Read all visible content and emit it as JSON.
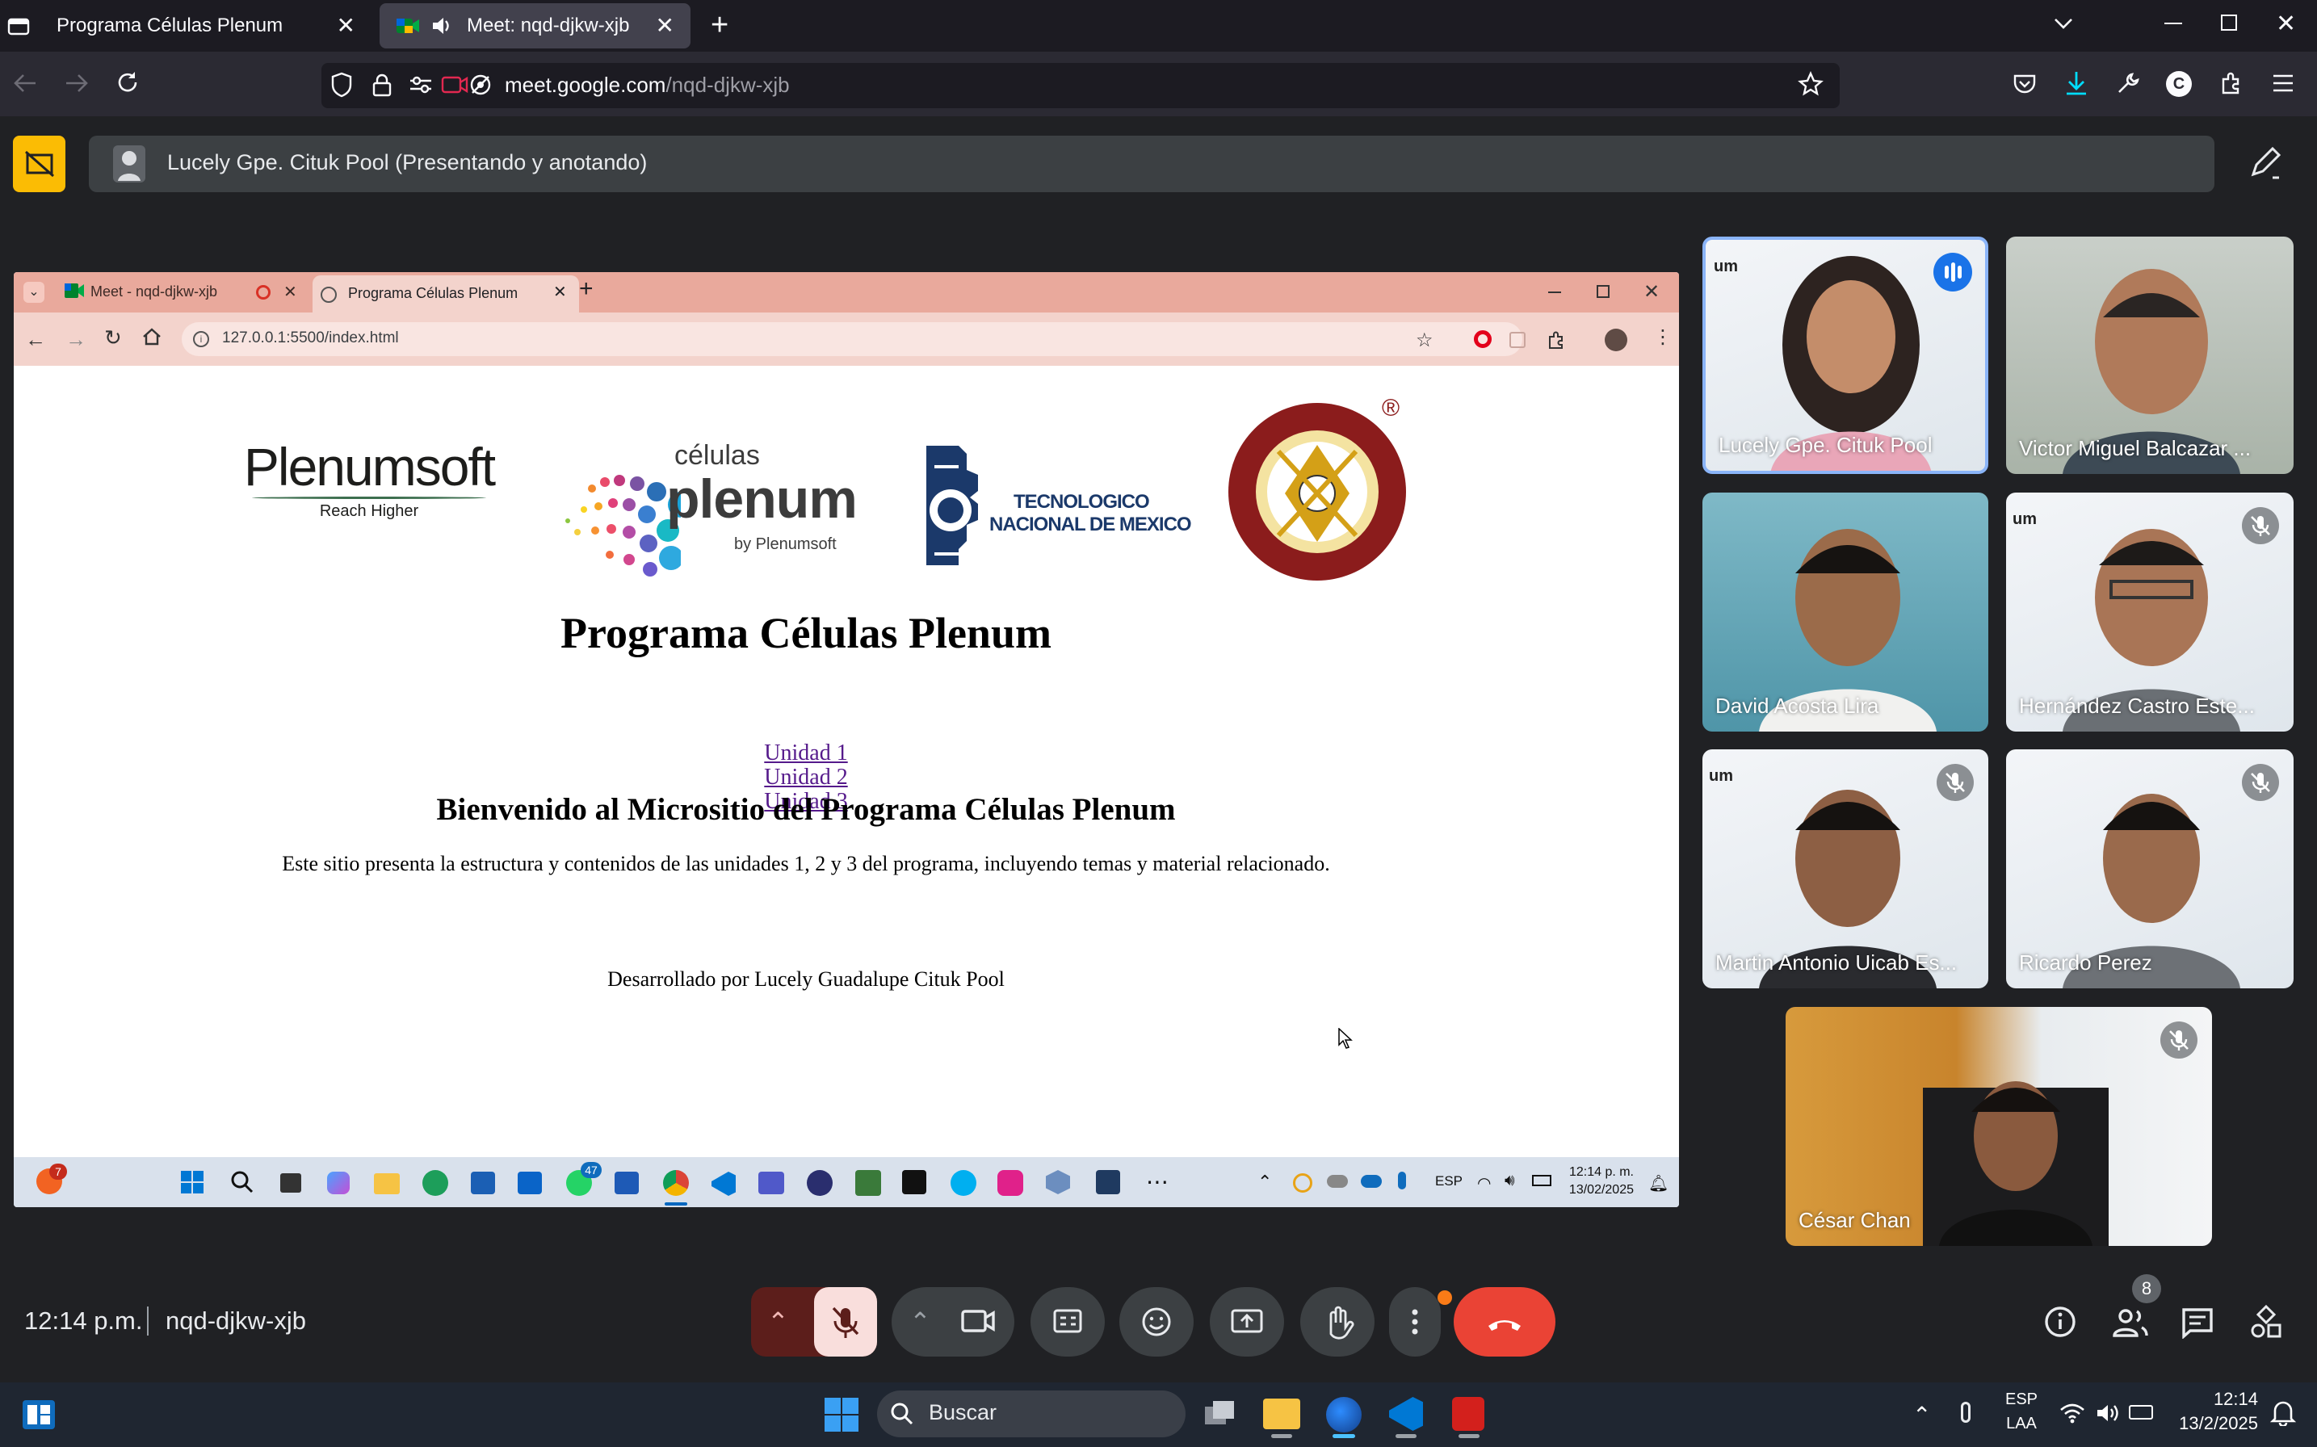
{
  "browser": {
    "tabs": [
      {
        "title": "Programa Células Plenum",
        "active": false
      },
      {
        "title": "Meet: nqd-djkw-xjb",
        "active": true
      }
    ],
    "url_domain": "meet.google.com",
    "url_path": "/nqd-djkw-xjb",
    "icons": [
      "all-tabs-icon",
      "audio-playing-icon",
      "new-tab-icon",
      "tab-list-chevron-icon",
      "minimize-icon",
      "restore-icon",
      "close-icon",
      "back-icon",
      "forward-icon",
      "reload-icon",
      "shield-icon",
      "lock-icon",
      "permissions-icon",
      "camera-blocked-icon",
      "tracking-icon",
      "bookmark-star-icon",
      "pocket-icon",
      "download-icon",
      "wrench-icon",
      "account-icon",
      "extensions-icon",
      "menu-icon"
    ]
  },
  "meet": {
    "presenter_label": "Lucely Gpe. Cituk Pool (Presentando y anotando)",
    "time": "12:14 p.m.",
    "meeting_code": "nqd-djkw-xjb",
    "people_count": "8",
    "accent": "#8ab4f8",
    "end_call_color": "#ea4335"
  },
  "shared_screen": {
    "tabs": [
      {
        "title": "Meet - nqd-djkw-xjb"
      },
      {
        "title": "Programa Células Plenum"
      }
    ],
    "url": "127.0.0.1:5500/index.html",
    "page": {
      "logos": {
        "plenumsoft": "Plenumsoft",
        "plenumsoft_tagline": "Reach Higher",
        "celulas_top": "células",
        "celulas_main": "plenum",
        "celulas_by": "by Plenumsoft",
        "tecnm_line1": "TECNOLOGICO",
        "tecnm_line2": "NACIONAL DE MEXICO",
        "itm_seal": "INSTITUTO TECNOLOGICO · MERIDA YUCATAN",
        "itm_mark": "®"
      },
      "title": "Programa Células Plenum",
      "links": [
        "Unidad 1",
        "Unidad 2",
        "Unidad 3"
      ],
      "welcome": "Bienvenido al Micrositio del Programa Células Plenum",
      "description": "Este sitio presenta la estructura y contenidos de las unidades 1, 2 y 3 del programa, incluyendo temas y material relacionado.",
      "developer": "Desarrollado por Lucely Guadalupe Cituk Pool"
    },
    "taskbar": {
      "notification_badge": "7",
      "whatsapp_badge": "47",
      "lang": "ESP",
      "time": "12:14 p. m.",
      "date": "13/02/2025"
    }
  },
  "participants": [
    {
      "name": "Lucely Gpe. Cituk Pool",
      "speaking": true,
      "muted": false
    },
    {
      "name": "Victor Miguel Balcazar ...",
      "speaking": false,
      "muted": false
    },
    {
      "name": "David Acosta Lira",
      "speaking": false,
      "muted": false
    },
    {
      "name": "Hernández Castro Este...",
      "speaking": false,
      "muted": true
    },
    {
      "name": "Martin Antonio Uicab Es...",
      "speaking": false,
      "muted": true
    },
    {
      "name": "Ricardo Perez",
      "speaking": false,
      "muted": true
    },
    {
      "name": "César Chan",
      "speaking": false,
      "muted": true
    }
  ],
  "windows_taskbar": {
    "search_placeholder": "Buscar",
    "lang_top": "ESP",
    "lang_bottom": "LAA",
    "time": "12:14",
    "date": "13/2/2025"
  }
}
